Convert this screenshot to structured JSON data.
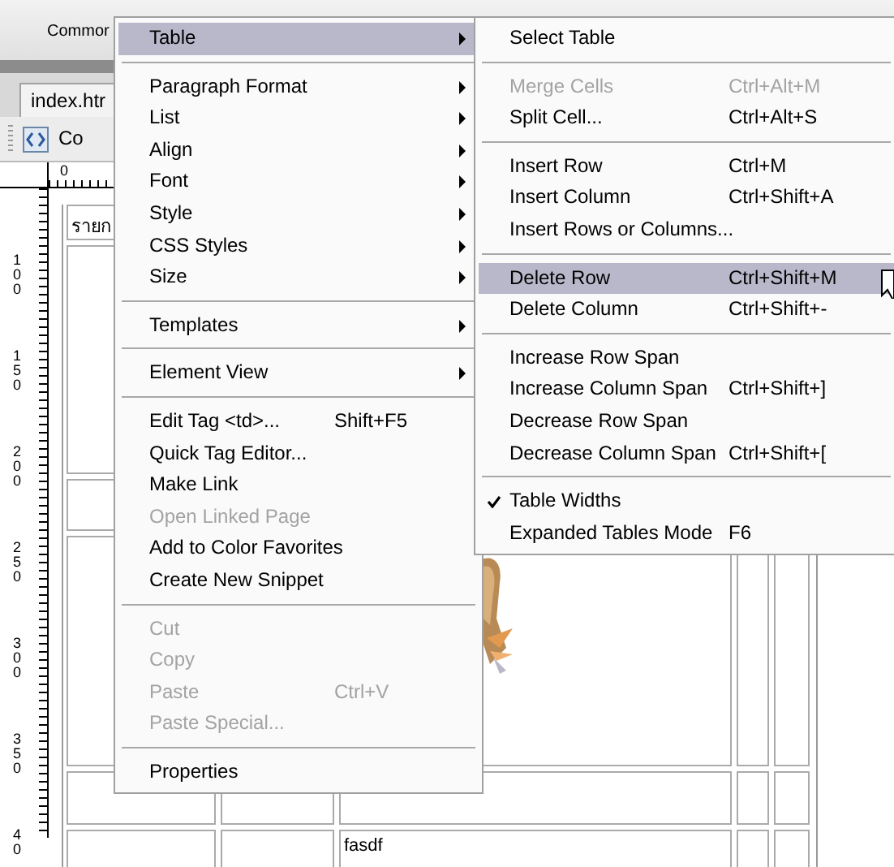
{
  "insert_bar": {
    "tab": "Commor"
  },
  "document_tab": {
    "label": "index.htr",
    "selected": true
  },
  "toolbar": {
    "view_button": "Co"
  },
  "rulers": {
    "top_label": "0",
    "left_labels": [
      "100",
      "150",
      "200",
      "250",
      "300",
      "350",
      "40"
    ]
  },
  "document": {
    "top_cell": "รายก",
    "bottom_cell": "fasdf"
  },
  "context_menu": {
    "items": [
      {
        "kind": "item",
        "label": "Table",
        "selected": true,
        "disabled": false,
        "submenu": true
      },
      {
        "kind": "separator"
      },
      {
        "kind": "item",
        "label": "Paragraph Format",
        "selected": false,
        "disabled": false,
        "submenu": true
      },
      {
        "kind": "item",
        "label": "List",
        "selected": false,
        "disabled": false,
        "submenu": true
      },
      {
        "kind": "item",
        "label": "Align",
        "selected": false,
        "disabled": false,
        "submenu": true
      },
      {
        "kind": "item",
        "label": "Font",
        "selected": false,
        "disabled": false,
        "submenu": true
      },
      {
        "kind": "item",
        "label": "Style",
        "selected": false,
        "disabled": false,
        "submenu": true
      },
      {
        "kind": "item",
        "label": "CSS Styles",
        "selected": false,
        "disabled": false,
        "submenu": true
      },
      {
        "kind": "item",
        "label": "Size",
        "selected": false,
        "disabled": false,
        "submenu": true
      },
      {
        "kind": "separator"
      },
      {
        "kind": "item",
        "label": "Templates",
        "selected": false,
        "disabled": false,
        "submenu": true
      },
      {
        "kind": "separator"
      },
      {
        "kind": "item",
        "label": "Element View",
        "selected": false,
        "disabled": false,
        "submenu": true
      },
      {
        "kind": "separator"
      },
      {
        "kind": "item",
        "label": "Edit Tag <td>...",
        "shortcut": "Shift+F5",
        "selected": false,
        "disabled": false,
        "submenu": false
      },
      {
        "kind": "item",
        "label": "Quick Tag Editor...",
        "selected": false,
        "disabled": false,
        "submenu": false
      },
      {
        "kind": "item",
        "label": "Make Link",
        "selected": false,
        "disabled": false,
        "submenu": false
      },
      {
        "kind": "item",
        "label": "Open Linked Page",
        "selected": false,
        "disabled": true,
        "submenu": false
      },
      {
        "kind": "item",
        "label": "Add to Color Favorites",
        "selected": false,
        "disabled": false,
        "submenu": false
      },
      {
        "kind": "item",
        "label": "Create New Snippet",
        "selected": false,
        "disabled": false,
        "submenu": false
      },
      {
        "kind": "separator"
      },
      {
        "kind": "item",
        "label": "Cut",
        "selected": false,
        "disabled": true,
        "submenu": false
      },
      {
        "kind": "item",
        "label": "Copy",
        "selected": false,
        "disabled": true,
        "submenu": false
      },
      {
        "kind": "item",
        "label": "Paste",
        "shortcut": "Ctrl+V",
        "selected": false,
        "disabled": true,
        "submenu": false
      },
      {
        "kind": "item",
        "label": "Paste Special...",
        "selected": false,
        "disabled": true,
        "submenu": false
      },
      {
        "kind": "separator"
      },
      {
        "kind": "item",
        "label": "Properties",
        "selected": false,
        "disabled": false,
        "submenu": false
      }
    ]
  },
  "table_submenu": {
    "items": [
      {
        "kind": "item",
        "label": "Select Table",
        "selected": false,
        "disabled": false,
        "checked": false
      },
      {
        "kind": "separator"
      },
      {
        "kind": "item",
        "label": "Merge Cells",
        "shortcut": "Ctrl+Alt+M",
        "selected": false,
        "disabled": true,
        "checked": false
      },
      {
        "kind": "item",
        "label": "Split Cell...",
        "shortcut": "Ctrl+Alt+S",
        "selected": false,
        "disabled": false,
        "checked": false
      },
      {
        "kind": "separator"
      },
      {
        "kind": "item",
        "label": "Insert Row",
        "shortcut": "Ctrl+M",
        "selected": false,
        "disabled": false,
        "checked": false
      },
      {
        "kind": "item",
        "label": "Insert Column",
        "shortcut": "Ctrl+Shift+A",
        "selected": false,
        "disabled": false,
        "checked": false
      },
      {
        "kind": "item",
        "label": "Insert Rows or Columns...",
        "selected": false,
        "disabled": false,
        "checked": false
      },
      {
        "kind": "separator"
      },
      {
        "kind": "item",
        "label": "Delete Row",
        "shortcut": "Ctrl+Shift+M",
        "selected": true,
        "disabled": false,
        "checked": false
      },
      {
        "kind": "item",
        "label": "Delete Column",
        "shortcut": "Ctrl+Shift+-",
        "selected": false,
        "disabled": false,
        "checked": false
      },
      {
        "kind": "separator"
      },
      {
        "kind": "item",
        "label": "Increase Row Span",
        "selected": false,
        "disabled": false,
        "checked": false
      },
      {
        "kind": "item",
        "label": "Increase Column Span",
        "shortcut": "Ctrl+Shift+]",
        "selected": false,
        "disabled": false,
        "checked": false
      },
      {
        "kind": "item",
        "label": "Decrease Row Span",
        "selected": false,
        "disabled": false,
        "checked": false
      },
      {
        "kind": "item",
        "label": "Decrease Column Span",
        "shortcut": "Ctrl+Shift+[",
        "selected": false,
        "disabled": false,
        "checked": false
      },
      {
        "kind": "separator"
      },
      {
        "kind": "item",
        "label": "Table Widths",
        "selected": false,
        "disabled": false,
        "checked": true
      },
      {
        "kind": "item",
        "label": "Expanded Tables Mode",
        "shortcut": "F6",
        "selected": false,
        "disabled": false,
        "checked": false
      }
    ]
  }
}
